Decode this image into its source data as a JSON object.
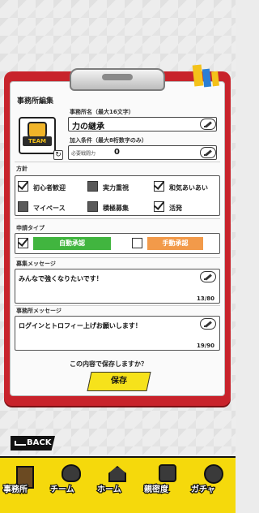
{
  "form": {
    "title": "事務所編集",
    "name_label": "事務所名（最大16文字）",
    "name_value": "力の継承",
    "join_label": "加入条件（最大8桁数字のみ）",
    "required_power_label": "必要戦闘力",
    "required_power_value": "0",
    "emblem_text": "TEAM",
    "policy_label": "方針",
    "policies": [
      {
        "label": "初心者歓迎",
        "checked": true
      },
      {
        "label": "実力重視",
        "checked": false
      },
      {
        "label": "和気あいあい",
        "checked": true
      },
      {
        "label": "マイペース",
        "checked": false
      },
      {
        "label": "積極募集",
        "checked": false
      },
      {
        "label": "活発",
        "checked": true
      }
    ],
    "apply_type_label": "申請タイプ",
    "auto_approve_label": "自動承認",
    "manual_approve_label": "手動承認",
    "recruit_msg_label": "募集メッセージ",
    "recruit_msg_value": "みんなで強くなりたいです！",
    "recruit_msg_count": "13/80",
    "office_msg_label": "事務所メッセージ",
    "office_msg_value": "ログインとトロフィー上げお願いします！",
    "office_msg_count": "19/90",
    "confirm_text": "この内容で保存しますか？",
    "save_label": "保存"
  },
  "back_label": "BACK",
  "nav": {
    "items": [
      {
        "label": "事務所",
        "icon": "office-icon"
      },
      {
        "label": "チーム",
        "icon": "team-icon"
      },
      {
        "label": "ホーム",
        "icon": "home-icon"
      },
      {
        "label": "親密度",
        "icon": "intimacy-icon"
      },
      {
        "label": "ガチャ",
        "icon": "gacha-icon"
      }
    ]
  },
  "colors": {
    "board": "#c8232b",
    "auto_approve": "#41b53f",
    "manual_approve": "#f29a4a",
    "save": "#f6e21b",
    "nav": "#f5d90c"
  }
}
